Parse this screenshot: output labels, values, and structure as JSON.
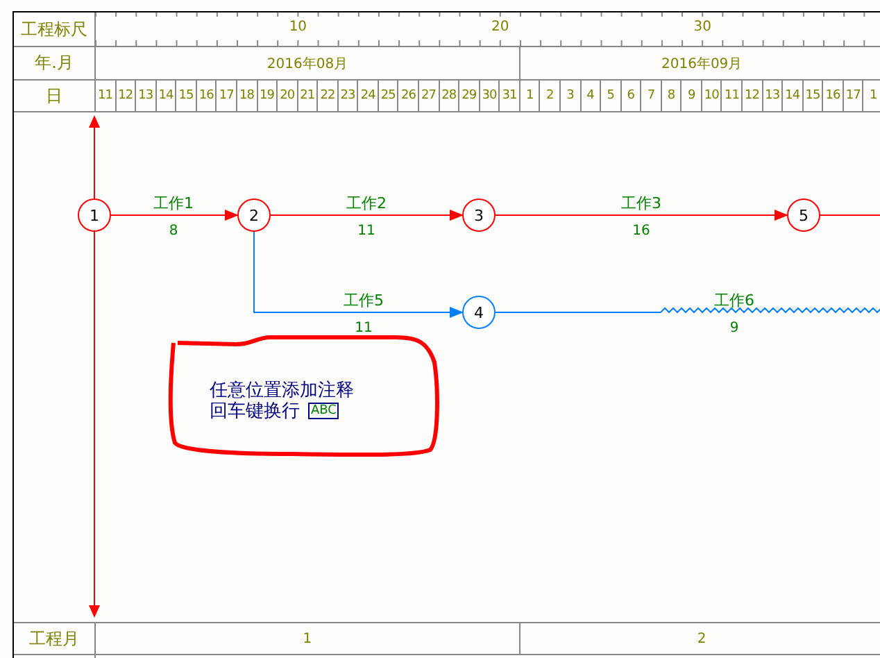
{
  "header": {
    "ruler_label": "工程标尺",
    "month_label": "年.月",
    "day_label": "日",
    "ruler_marks": [
      "10",
      "20",
      "30"
    ],
    "months": [
      {
        "label": "2016年08月",
        "days": [
          "11",
          "12",
          "13",
          "14",
          "15",
          "16",
          "17",
          "18",
          "19",
          "20",
          "21",
          "22",
          "23",
          "24",
          "25",
          "26",
          "27",
          "28",
          "29",
          "30",
          "31"
        ]
      },
      {
        "label": "2016年09月",
        "days": [
          "1",
          "2",
          "3",
          "4",
          "5",
          "6",
          "7",
          "8",
          "9",
          "10",
          "11",
          "12",
          "13",
          "14",
          "15",
          "16",
          "17",
          "1"
        ]
      }
    ]
  },
  "network": {
    "nodes": [
      "1",
      "2",
      "3",
      "5",
      "4"
    ],
    "activities": [
      {
        "name": "工作1",
        "duration": "8",
        "kind": "critical"
      },
      {
        "name": "工作2",
        "duration": "11",
        "kind": "critical"
      },
      {
        "name": "工作3",
        "duration": "16",
        "kind": "critical"
      },
      {
        "name": "工作5",
        "duration": "11",
        "kind": "noncritical"
      },
      {
        "name": "工作6",
        "duration": "9",
        "kind": "free_float"
      }
    ],
    "note": {
      "lines": [
        "任意位置添加注释",
        "回车键换行"
      ],
      "tag": "ABC"
    }
  },
  "footer": {
    "label": "工程月",
    "months": [
      "1",
      "2"
    ]
  }
}
